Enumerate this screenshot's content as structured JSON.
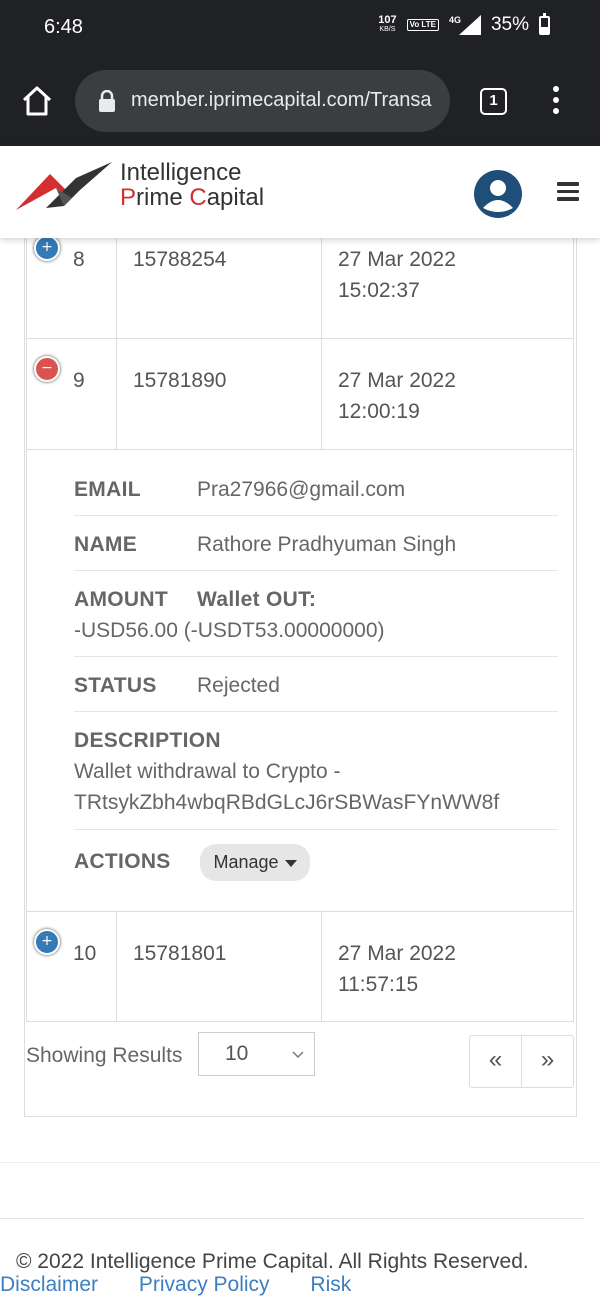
{
  "status_bar": {
    "time": "6:48",
    "speed_value": "107",
    "speed_unit": "KB/S",
    "volte": "Vo LTE",
    "network": "4G",
    "battery": "35%"
  },
  "browser": {
    "url": "member.iprimecapital.com/Transa",
    "tab_count": "1"
  },
  "site": {
    "brand_line1": "Intelligence",
    "brand_line2_prefix": "P",
    "brand_line2_rest": "rime ",
    "brand_line2_prefix2": "C",
    "brand_line2_rest2": "apital",
    "brand_color": "#d32f2f"
  },
  "table": {
    "rows": [
      {
        "index": "8",
        "id": "15788254",
        "date": "27 Mar 2022",
        "time": "15:02:37",
        "expanded": false
      },
      {
        "index": "9",
        "id": "15781890",
        "date": "27 Mar 2022",
        "time": "12:00:19",
        "expanded": true
      },
      {
        "index": "10",
        "id": "15781801",
        "date": "27 Mar 2022",
        "time": "11:57:15",
        "expanded": false
      }
    ],
    "detail": {
      "email_label": "EMAIL",
      "email_value": "Pra27966@gmail.com",
      "name_label": "NAME",
      "name_value": "Rathore Pradhyuman Singh",
      "amount_label": "AMOUNT",
      "amount_type": "Wallet OUT:",
      "amount_value": "-USD56.00 (-USDT53.00000000)",
      "status_label": "STATUS",
      "status_value": "Rejected",
      "description_label": "DESCRIPTION",
      "description_line1": "Wallet withdrawal to Crypto -",
      "description_line2": "TRtsykZbh4wbqRBdGLcJ6rSBWasFYnWW8f",
      "actions_label": "ACTIONS",
      "manage_label": "Manage"
    }
  },
  "pagination": {
    "showing_label": "Showing Results",
    "page_size": "10",
    "prev": "«",
    "next": "»"
  },
  "footer": {
    "copyright": "© 2022 Intelligence Prime Capital. All Rights Reserved.",
    "links": [
      "Disclaimer",
      "Privacy Policy",
      "Risk"
    ]
  },
  "colors": {
    "expand_blue": "#337ab7",
    "collapse_red": "#d9534f",
    "link_blue": "#3d7fc1"
  }
}
